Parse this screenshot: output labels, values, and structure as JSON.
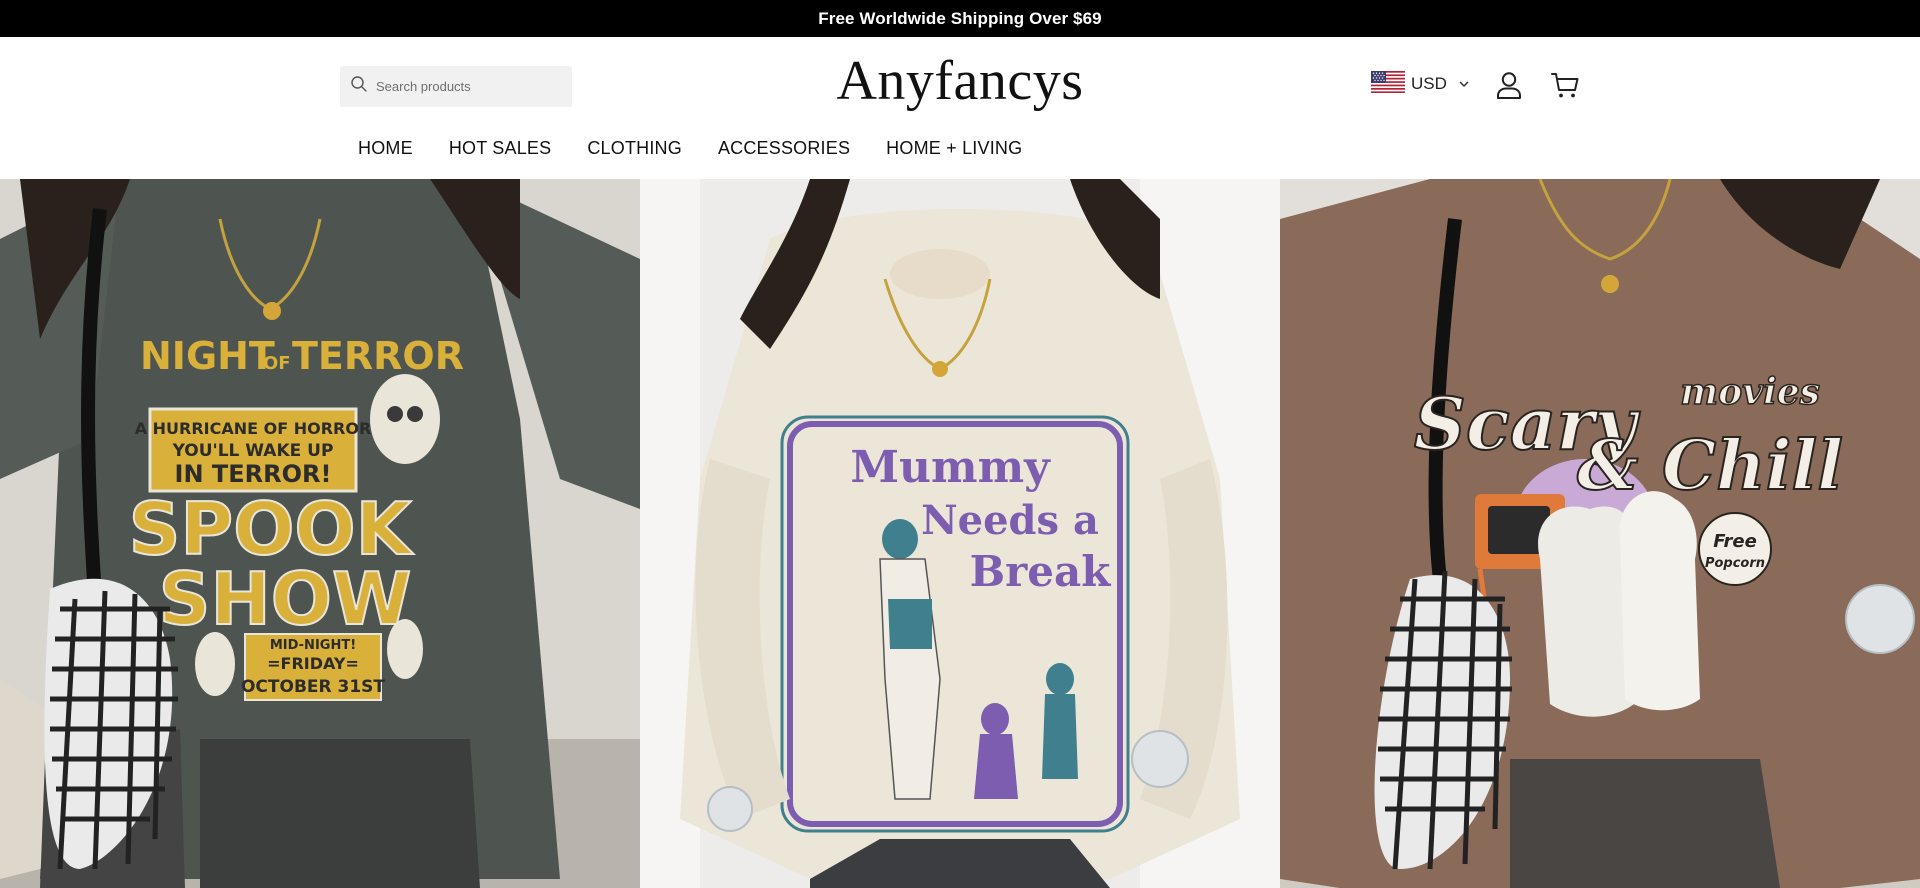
{
  "announcement": {
    "text": "Free Worldwide Shipping Over $69"
  },
  "header": {
    "logo": "Anyfancys",
    "search": {
      "placeholder": "Search products",
      "value": ""
    },
    "currency": {
      "code": "USD",
      "flag": "us-flag-icon"
    },
    "icons": {
      "account": "user-icon",
      "cart": "cart-icon",
      "search": "search-icon"
    }
  },
  "nav": {
    "items": [
      {
        "label": "HOME"
      },
      {
        "label": "HOT SALES"
      },
      {
        "label": "CLOTHING"
      },
      {
        "label": "ACCESSORIES"
      },
      {
        "label": "HOME + LIVING"
      }
    ]
  },
  "hero": {
    "slides": [
      {
        "print_lines": [
          "NIGHT OF TERROR",
          "A HURRICANE OF HORROR",
          "YOU'LL WAKE UP",
          "IN TERROR!",
          "SPOOK",
          "SHOW",
          "MID-NIGHT!",
          "=FRIDAY=",
          "OCTOBER 31ST"
        ],
        "color": "#4e5551"
      },
      {
        "print_lines": [
          "Mummy",
          "Needs a",
          "Break"
        ],
        "color": "#ece6d8"
      },
      {
        "print_lines": [
          "Scary",
          "movies",
          "& Chill",
          "Free",
          "Popcorn"
        ],
        "color": "#8a6a58"
      }
    ]
  },
  "colors": {
    "announcement_bg": "#000000",
    "page_bg": "#ffffff",
    "search_bg": "#f1f1f1"
  }
}
